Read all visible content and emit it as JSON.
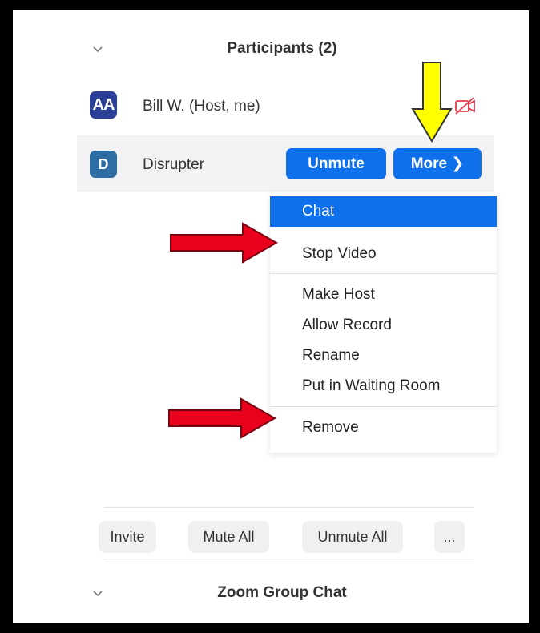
{
  "participants_header": {
    "title": "Participants (2)"
  },
  "participants": [
    {
      "initials": "AA",
      "name": "Bill W. (Host, me)",
      "avatar_color": "#2b3f96"
    },
    {
      "initials": "D",
      "name": "Disrupter",
      "avatar_color": "#2e6da4"
    }
  ],
  "row_actions": {
    "unmute_label": "Unmute",
    "more_label": "More ❯"
  },
  "context_menu": {
    "items": [
      {
        "label": "Chat",
        "active": true
      },
      {
        "label": "Stop Video"
      },
      {
        "label": "Make Host"
      },
      {
        "label": "Allow Record"
      },
      {
        "label": "Rename"
      },
      {
        "label": "Put in Waiting Room"
      },
      {
        "label": "Remove"
      }
    ]
  },
  "footer_buttons": {
    "invite": "Invite",
    "mute_all": "Mute All",
    "unmute_all": "Unmute All",
    "more": "..."
  },
  "chat_header": {
    "title": "Zoom Group Chat"
  },
  "icons": {
    "collapse": "chevron-down-icon",
    "video_off": "video-off-icon",
    "annotation_yellow": "arrow-down-icon",
    "annotation_red": "arrow-right-icon"
  },
  "colors": {
    "accent": "#0e71eb",
    "video_off_icon": "#e8374a",
    "annotation_yellow": "#ffff00",
    "annotation_red": "#e8001c"
  }
}
